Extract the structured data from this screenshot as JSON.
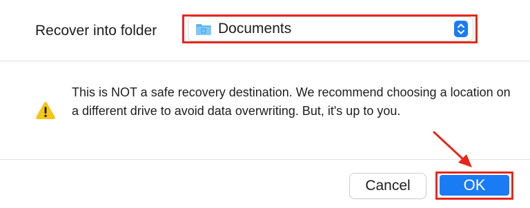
{
  "folder": {
    "label": "Recover into folder",
    "selected_value": "Documents",
    "icon": "folder-icon"
  },
  "warning": {
    "icon": "warning-triangle-icon",
    "message": "This is NOT a safe recovery destination. We recommend choosing a location on a different drive to avoid data overwriting. But, it's up to you."
  },
  "buttons": {
    "cancel_label": "Cancel",
    "ok_label": "OK"
  },
  "colors": {
    "accent": "#1a7cf5",
    "annotation": "#e8261b",
    "warning": "#f5c518"
  }
}
